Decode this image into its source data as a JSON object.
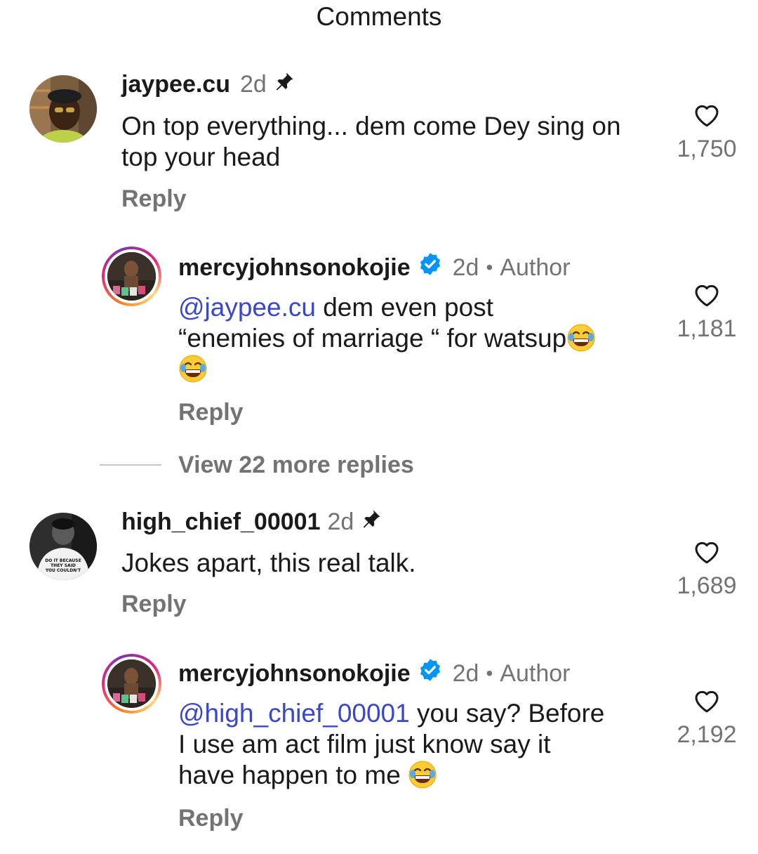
{
  "sheet": {
    "title": "Comments"
  },
  "comments": [
    {
      "username": "jaypee.cu",
      "time": "2d",
      "text": "On top everything... dem come Dey sing on top your head",
      "reply_label": "Reply",
      "likes": "1,750"
    },
    {
      "username": "mercyjohnsonokojie",
      "time": "2d",
      "separator": "•",
      "author_label": "Author",
      "mention": "@jaypee.cu",
      "text_line1": " dem even post",
      "text_line2": "“enemies of marriage “ for watsup",
      "reply_label": "Reply",
      "likes": "1,181"
    },
    {
      "username": "high_chief_00001",
      "time": "2d",
      "text": "Jokes apart, this real talk.",
      "reply_label": "Reply",
      "likes": "1,689",
      "avatar_shirt_text": [
        "DO IT BECAUSE",
        "THEY SAID",
        "YOU COULDN'T"
      ]
    },
    {
      "username": "mercyjohnsonokojie",
      "time": "2d",
      "separator": "•",
      "author_label": "Author",
      "mention": "@high_chief_00001",
      "text_line1": " you say? Before",
      "text_line2": "I use am act film just know say it",
      "text_line3": "have happen to me ",
      "reply_label": "Reply",
      "likes": "2,192"
    }
  ],
  "view_more": {
    "label": "View 22 more replies"
  },
  "icons": {
    "like": "heart-outline-icon",
    "pin": "pin-icon",
    "verified": "verified-badge-icon",
    "emoji": "face-with-tears-of-joy-emoji"
  },
  "colors": {
    "mention": "#3a47c9",
    "muted": "#737373",
    "verified": "#0095f6"
  }
}
